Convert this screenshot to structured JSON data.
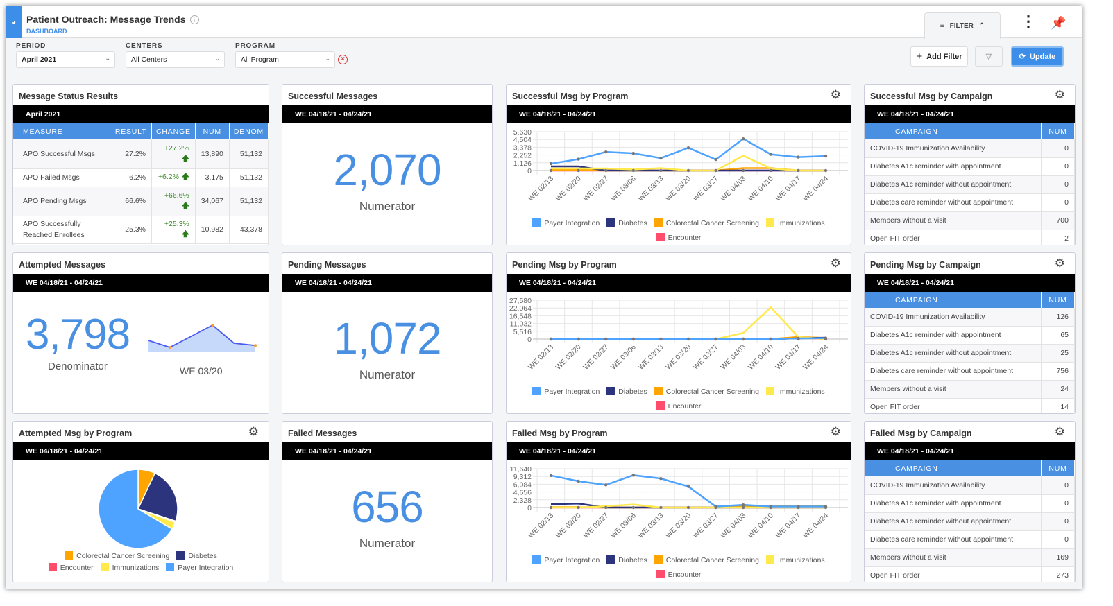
{
  "header": {
    "title": "Patient Outreach: Message Trends",
    "subtitle": "DASHBOARD",
    "filter_tab": "FILTER"
  },
  "filters": {
    "period_label": "PERIOD",
    "period_value": "April 2021",
    "centers_label": "CENTERS",
    "centers_value": "All Centers",
    "program_label": "PROGRAM",
    "program_value": "All Program",
    "add_filter": "Add Filter",
    "update": "Update"
  },
  "colors": {
    "accent": "#3d8ee8",
    "Payer Integration": "#4da3ff",
    "Diabetes": "#2b347c",
    "Colorectal Cancer Screening": "#ffa500",
    "Immunizations": "#ffe94d",
    "Encounter": "#ff4d6b"
  },
  "period_bar": "WE 04/18/21 - 04/24/21",
  "status": {
    "title": "Message Status Results",
    "bar": "April 2021",
    "columns": [
      "MEASURE",
      "RESULT",
      "CHANGE",
      "NUM",
      "DENOM"
    ],
    "rows": [
      [
        "APO Successful Msgs",
        "27.2%",
        "+27.2%",
        "13,890",
        "51,132"
      ],
      [
        "APO Failed Msgs",
        "6.2%",
        "+6.2%",
        "3,175",
        "51,132"
      ],
      [
        "APO Pending Msgs",
        "66.6%",
        "+66.6%",
        "34,067",
        "51,132"
      ],
      [
        "APO Successfully Reached Enrollees",
        "25.3%",
        "+25.3%",
        "10,982",
        "43,378"
      ]
    ]
  },
  "successful": {
    "title": "Successful Messages",
    "value": "2,070",
    "label": "Numerator"
  },
  "attempted": {
    "title": "Attempted Messages",
    "value": "3,798",
    "label": "Denominator",
    "spark_label": "WE 03/20",
    "spark_values": [
      40,
      15,
      55,
      95,
      30,
      22
    ]
  },
  "pending": {
    "title": "Pending Messages",
    "value": "1,072",
    "label": "Numerator"
  },
  "failed": {
    "title": "Failed Messages",
    "value": "656",
    "label": "Numerator"
  },
  "weeks": [
    "WE 02/13",
    "WE 02/20",
    "WE 02/27",
    "WE 03/06",
    "WE 03/13",
    "WE 03/20",
    "WE 03/27",
    "WE 04/03",
    "WE 04/10",
    "WE 04/17",
    "WE 04/24"
  ],
  "chart_data": [
    {
      "type": "line",
      "title": "Successful Msg by Program",
      "ylim": [
        0,
        5630
      ],
      "yticks": [
        "5,630",
        "4,504",
        "3,378",
        "2,252",
        "1,126",
        "0"
      ],
      "series": [
        {
          "name": "Payer Integration",
          "values": [
            1000,
            1650,
            2700,
            2500,
            1800,
            3300,
            1600,
            4600,
            2350,
            1950,
            2100
          ]
        },
        {
          "name": "Diabetes",
          "values": [
            600,
            600,
            0,
            0,
            0,
            0,
            0,
            0,
            0,
            0,
            0
          ]
        },
        {
          "name": "Colorectal Cancer Screening",
          "values": [
            100,
            100,
            0,
            0,
            0,
            0,
            0,
            350,
            350,
            0,
            0
          ]
        },
        {
          "name": "Immunizations",
          "values": [
            300,
            300,
            300,
            150,
            350,
            0,
            0,
            2150,
            300,
            0,
            0
          ]
        },
        {
          "name": "Encounter",
          "values": [
            0,
            0,
            0,
            0,
            0,
            0,
            0,
            0,
            0,
            0,
            0
          ]
        }
      ]
    },
    {
      "type": "line",
      "title": "Pending Msg by Program",
      "ylim": [
        0,
        27580
      ],
      "yticks": [
        "27,580",
        "22,064",
        "16,548",
        "11,032",
        "5,516",
        "0"
      ],
      "series": [
        {
          "name": "Payer Integration",
          "values": [
            0,
            0,
            0,
            0,
            0,
            0,
            0,
            0,
            0,
            500,
            700
          ]
        },
        {
          "name": "Diabetes",
          "values": [
            0,
            0,
            0,
            0,
            0,
            0,
            0,
            0,
            0,
            500,
            1000
          ]
        },
        {
          "name": "Colorectal Cancer Screening",
          "values": [
            0,
            0,
            0,
            0,
            0,
            0,
            0,
            0,
            0,
            1500,
            800
          ]
        },
        {
          "name": "Immunizations",
          "values": [
            0,
            0,
            0,
            0,
            0,
            0,
            0,
            4300,
            22500,
            1500,
            0
          ]
        },
        {
          "name": "Encounter",
          "values": [
            0,
            0,
            0,
            0,
            0,
            0,
            0,
            0,
            0,
            1200,
            0
          ]
        }
      ]
    },
    {
      "type": "line",
      "title": "Failed Msg by Program",
      "ylim": [
        0,
        11640
      ],
      "yticks": [
        "11,640",
        "9,312",
        "6,984",
        "4,656",
        "2,328",
        "0"
      ],
      "series": [
        {
          "name": "Payer Integration",
          "values": [
            9600,
            7900,
            6800,
            9700,
            8700,
            6300,
            300,
            800,
            300,
            300,
            300
          ]
        },
        {
          "name": "Diabetes",
          "values": [
            1000,
            1200,
            0,
            0,
            0,
            0,
            0,
            0,
            0,
            0,
            0
          ]
        },
        {
          "name": "Colorectal Cancer Screening",
          "values": [
            100,
            100,
            0,
            0,
            0,
            0,
            0,
            400,
            500,
            500,
            500
          ]
        },
        {
          "name": "Immunizations",
          "values": [
            0,
            0,
            400,
            900,
            0,
            0,
            0,
            0,
            0,
            0,
            0
          ]
        },
        {
          "name": "Encounter",
          "values": [
            0,
            0,
            0,
            0,
            0,
            0,
            0,
            0,
            0,
            0,
            0
          ]
        }
      ]
    },
    {
      "type": "pie",
      "title": "Attempted Msg by Program",
      "labels": [
        "Colorectal Cancer Screening",
        "Diabetes",
        "Encounter",
        "Immunizations",
        "Payer Integration"
      ],
      "values": [
        7,
        23,
        0.5,
        3,
        66.5
      ]
    }
  ],
  "campaigns": [
    {
      "title": "Successful Msg by Campaign",
      "columns": [
        "CAMPAIGN",
        "NUM"
      ],
      "rows": [
        [
          "COVID-19 Immunization Availability",
          "0"
        ],
        [
          "Diabetes A1c reminder with appointment",
          "0"
        ],
        [
          "Diabetes A1c reminder without appointment",
          "0"
        ],
        [
          "Diabetes care reminder without appointment",
          "0"
        ],
        [
          "Members without a visit",
          "700"
        ],
        [
          "Open FIT order",
          "2"
        ]
      ]
    },
    {
      "title": "Pending Msg by Campaign",
      "columns": [
        "CAMPAIGN",
        "NUM"
      ],
      "rows": [
        [
          "COVID-19 Immunization Availability",
          "126"
        ],
        [
          "Diabetes A1c reminder with appointment",
          "65"
        ],
        [
          "Diabetes A1c reminder without appointment",
          "25"
        ],
        [
          "Diabetes care reminder without appointment",
          "756"
        ],
        [
          "Members without a visit",
          "24"
        ],
        [
          "Open FIT order",
          "14"
        ]
      ]
    },
    {
      "title": "Failed Msg by Campaign",
      "columns": [
        "CAMPAIGN",
        "NUM"
      ],
      "rows": [
        [
          "COVID-19 Immunization Availability",
          "0"
        ],
        [
          "Diabetes A1c reminder with appointment",
          "0"
        ],
        [
          "Diabetes A1c reminder without appointment",
          "0"
        ],
        [
          "Diabetes care reminder without appointment",
          "0"
        ],
        [
          "Members without a visit",
          "169"
        ],
        [
          "Open FIT order",
          "273"
        ]
      ]
    }
  ]
}
